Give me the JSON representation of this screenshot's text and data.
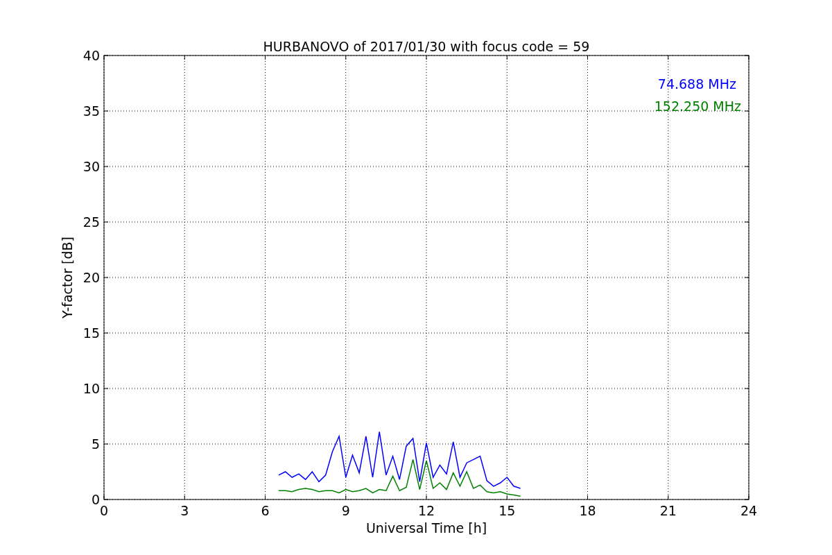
{
  "chart_data": {
    "type": "line",
    "title": "HURBANOVO of 2017/01/30 with focus code = 59",
    "xlabel": "Universal Time [h]",
    "ylabel": "Y-factor [dB]",
    "x": [
      6.5,
      6.75,
      7,
      7.25,
      7.5,
      7.75,
      8,
      8.25,
      8.5,
      8.75,
      9,
      9.25,
      9.5,
      9.75,
      10,
      10.25,
      10.5,
      10.75,
      11,
      11.25,
      11.5,
      11.75,
      12,
      12.25,
      12.5,
      12.75,
      13,
      13.25,
      13.5,
      13.75,
      14,
      14.25,
      14.5,
      14.75,
      15,
      15.25,
      15.5
    ],
    "series": [
      {
        "name": "74.688 MHz",
        "color": "#0000ff",
        "values": [
          2.2,
          2.5,
          2.0,
          2.3,
          1.8,
          2.5,
          1.6,
          2.2,
          4.3,
          5.7,
          2.0,
          4.0,
          2.4,
          5.7,
          2.0,
          6.1,
          2.2,
          3.9,
          1.8,
          4.8,
          5.5,
          1.6,
          5.1,
          2.0,
          3.1,
          2.3,
          5.2,
          2.0,
          3.3,
          3.6,
          3.9,
          1.7,
          1.2,
          1.5,
          2.0,
          1.2,
          1.0
        ]
      },
      {
        "name": "152.250 MHz",
        "color": "#008000",
        "values": [
          0.8,
          0.8,
          0.7,
          0.9,
          1.0,
          0.9,
          0.7,
          0.8,
          0.8,
          0.6,
          0.9,
          0.7,
          0.8,
          1.0,
          0.6,
          0.9,
          0.8,
          2.1,
          0.8,
          1.1,
          3.6,
          0.9,
          3.5,
          1.0,
          1.5,
          0.9,
          2.4,
          1.2,
          2.5,
          1.0,
          1.3,
          0.7,
          0.6,
          0.7,
          0.5,
          0.4,
          0.3
        ]
      }
    ],
    "xlim": [
      0,
      24
    ],
    "ylim": [
      0,
      40
    ],
    "xticks": [
      0,
      3,
      6,
      9,
      12,
      15,
      18,
      21,
      24
    ],
    "yticks": [
      0,
      5,
      10,
      15,
      20,
      25,
      30,
      35,
      40
    ],
    "grid": true
  }
}
